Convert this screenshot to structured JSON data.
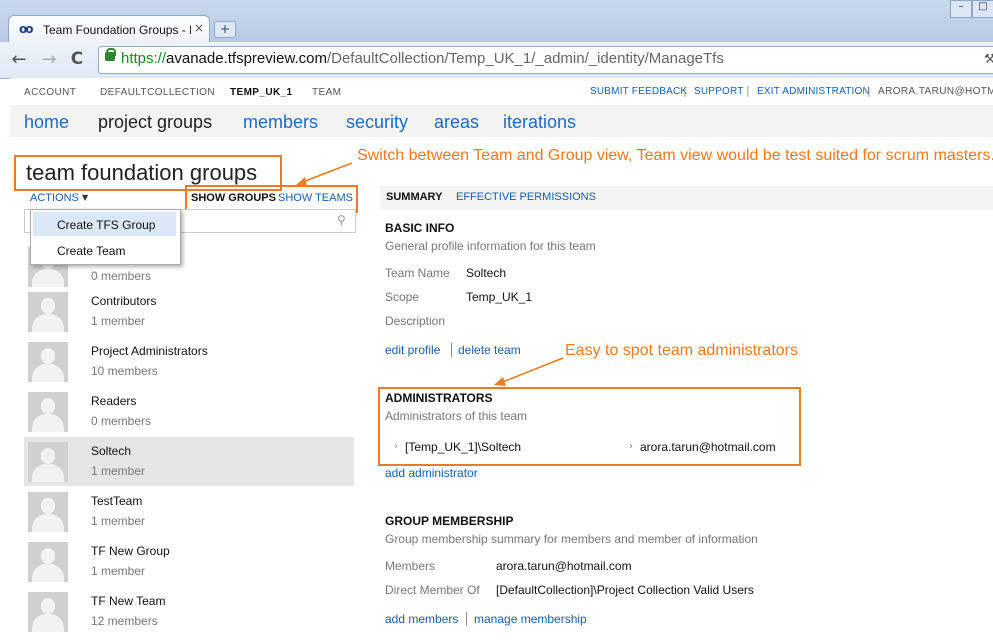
{
  "browser": {
    "tab_title": "Team Foundation Groups - Mic",
    "tab_close": "×",
    "new_tab": "+",
    "win_min": "–",
    "win_max": "□",
    "url_https": "https://",
    "url_host": "avanade.tfspreview.com",
    "url_path": "/DefaultCollection/Temp_UK_1/_admin/_identity/ManageTfs",
    "back": "←",
    "forward": "→",
    "reload": "C"
  },
  "topnav": {
    "crumbs": [
      "ACCOUNT",
      "DEFAULTCOLLECTION",
      "TEMP_UK_1",
      "TEAM"
    ],
    "links": [
      "SUBMIT FEEDBACK",
      "SUPPORT",
      "EXIT ADMINISTRATION"
    ],
    "user": "ARORA.TARUN@HOTM"
  },
  "mainnav": {
    "tabs": [
      "home",
      "project groups",
      "members",
      "security",
      "areas",
      "iterations"
    ],
    "active": "project groups"
  },
  "left": {
    "page_title": "team foundation groups",
    "actions_label": "ACTIONS",
    "show_groups": "SHOW GROUPS",
    "show_teams": "SHOW TEAMS",
    "dropdown": [
      "Create TFS Group",
      "Create Team"
    ],
    "groups": [
      {
        "name": "",
        "count": "0 members"
      },
      {
        "name": "Contributors",
        "count": "1 member"
      },
      {
        "name": "Project Administrators",
        "count": "10 members"
      },
      {
        "name": "Readers",
        "count": "0 members"
      },
      {
        "name": "Soltech",
        "count": "1 member"
      },
      {
        "name": "TestTeam",
        "count": "1 member"
      },
      {
        "name": "TF New Group",
        "count": "1 member"
      },
      {
        "name": "TF New Team",
        "count": "12 members"
      }
    ],
    "selected_group": "Soltech"
  },
  "right": {
    "tabs": [
      "SUMMARY",
      "EFFECTIVE PERMISSIONS"
    ],
    "basic_info": {
      "title": "BASIC INFO",
      "subtitle": "General profile information for this team",
      "team_name_label": "Team Name",
      "team_name": "Soltech",
      "scope_label": "Scope",
      "scope": "Temp_UK_1",
      "description_label": "Description",
      "edit_profile": "edit profile",
      "delete_team": "delete team"
    },
    "administrators": {
      "title": "ADMINISTRATORS",
      "subtitle": "Administrators of this team",
      "entries": [
        "[Temp_UK_1]\\Soltech",
        "arora.tarun@hotmail.com"
      ],
      "add": "add administrator"
    },
    "membership": {
      "title": "GROUP MEMBERSHIP",
      "subtitle": "Group membership summary for members and member of information",
      "members_label": "Members",
      "members": "arora.tarun@hotmail.com",
      "direct_label": "Direct Member Of",
      "direct": "[DefaultCollection]\\Project Collection Valid Users",
      "add_members": "add members",
      "manage": "manage membership"
    }
  },
  "annotations": {
    "view_note": "Switch between Team and Group view, Team view would be test suited for scrum masters.",
    "admin_note": "Easy to spot team administrators",
    "color": "#f07a22"
  }
}
